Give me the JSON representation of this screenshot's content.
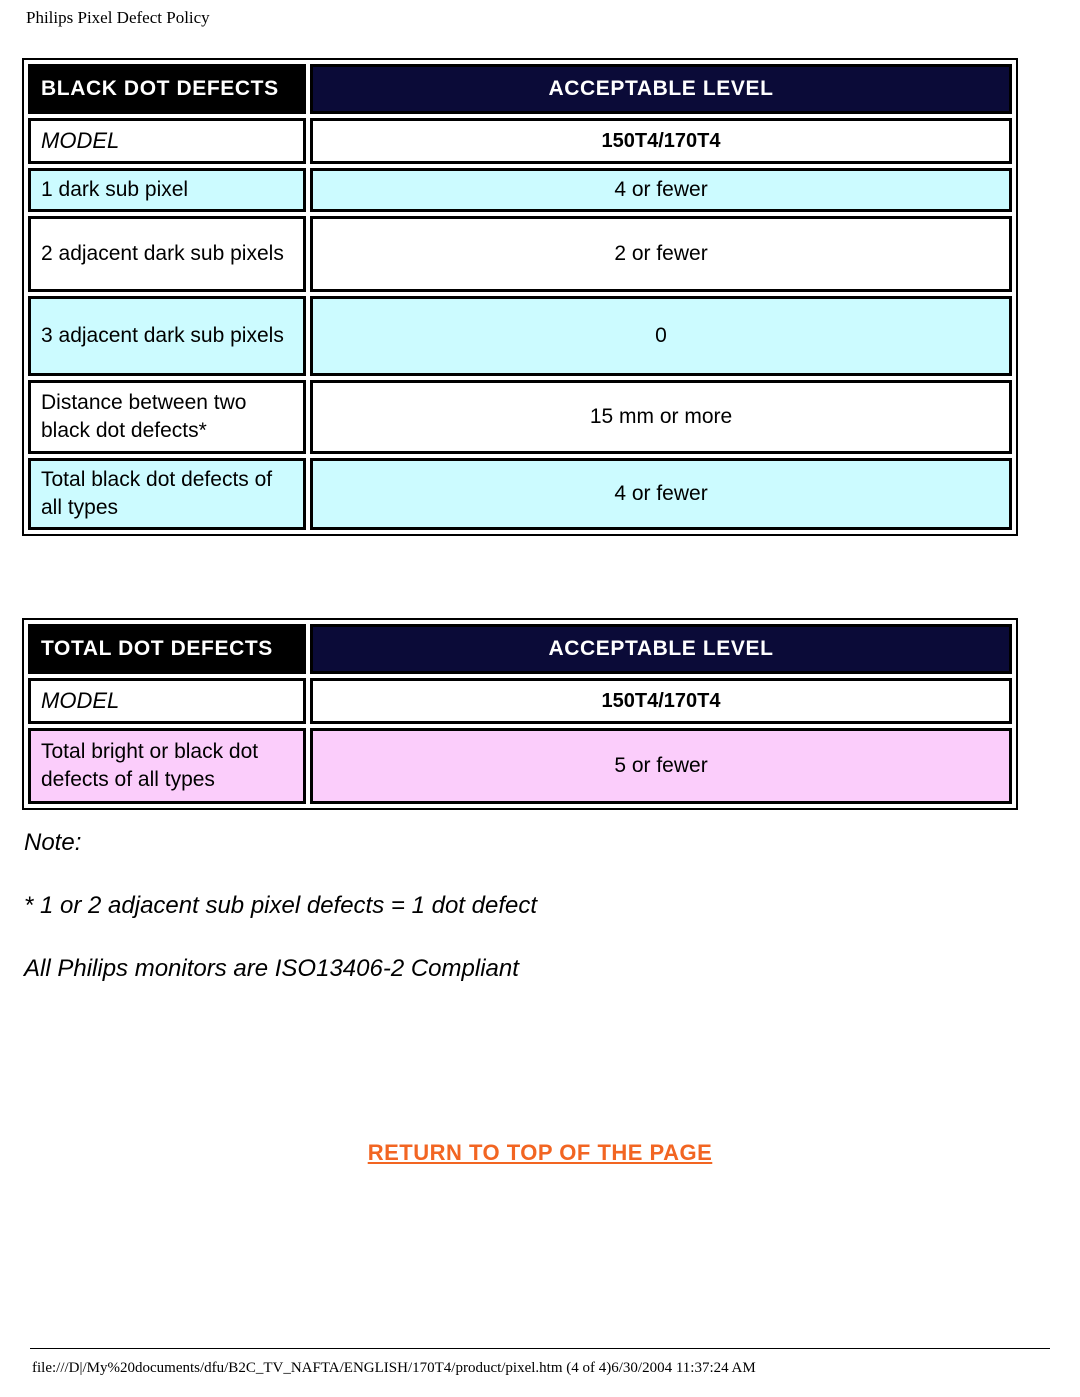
{
  "page": {
    "title": "Philips Pixel Defect Policy"
  },
  "colors": {
    "header_black": "#000000",
    "header_navy": "#0b0b38",
    "row_cyan": "#ccfbff",
    "row_pink": "#fbcdfb",
    "link_orange": "#f26522"
  },
  "tables": [
    {
      "id": "black-dot-defects",
      "header_left": "BLACK DOT DEFECTS",
      "header_right": "ACCEPTABLE LEVEL",
      "model_label": "MODEL",
      "model_value": "150T4/170T4",
      "rows": [
        {
          "label": "1 dark sub pixel",
          "value": "4 or fewer",
          "shade": "cyan"
        },
        {
          "label": "2 adjacent dark sub pixels",
          "value": "2 or fewer",
          "shade": "white"
        },
        {
          "label": "3 adjacent dark sub pixels",
          "value": "0",
          "shade": "cyan"
        },
        {
          "label": "Distance between two black dot defects*",
          "value": "15 mm or more",
          "shade": "white"
        },
        {
          "label": "Total black dot defects of all types",
          "value": "4 or fewer",
          "shade": "cyan"
        }
      ]
    },
    {
      "id": "total-dot-defects",
      "header_left": "TOTAL DOT DEFECTS",
      "header_right": "ACCEPTABLE LEVEL",
      "model_label": "MODEL",
      "model_value": "150T4/170T4",
      "rows": [
        {
          "label": "Total bright or black dot defects of all types",
          "value": "5 or fewer",
          "shade": "pink"
        }
      ]
    }
  ],
  "note": {
    "heading": "Note:",
    "line1": "* 1 or 2 adjacent sub pixel defects = 1 dot defect",
    "line2": "All Philips monitors are ISO13406-2 Compliant"
  },
  "return_link": {
    "label": "RETURN TO TOP OF THE PAGE"
  },
  "footer": {
    "path": "file:///D|/My%20documents/dfu/B2C_TV_NAFTA/ENGLISH/170T4/product/pixel.htm (4 of 4)6/30/2004 11:37:24 AM"
  }
}
